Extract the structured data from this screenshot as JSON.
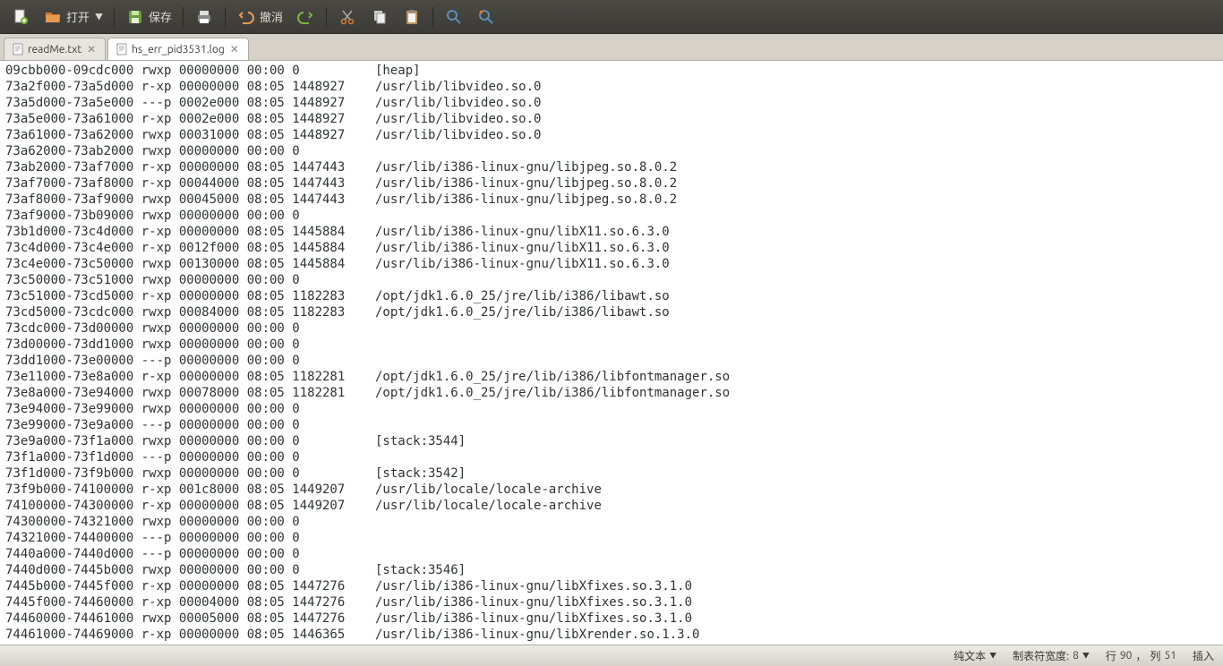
{
  "toolbar": {
    "new_label": "",
    "open_label": "打开",
    "save_label": "保存",
    "print_label": "",
    "undo_label": "撤消",
    "redo_label": "",
    "cut_label": "",
    "copy_label": "",
    "paste_label": "",
    "find_label": "",
    "replace_label": ""
  },
  "tabs": [
    {
      "label": "readMe.txt",
      "active": false
    },
    {
      "label": "hs_err_pid3531.log",
      "active": true
    }
  ],
  "editor_lines": [
    "09cbb000-09cdc000 rwxp 00000000 00:00 0          [heap]",
    "73a2f000-73a5d000 r-xp 00000000 08:05 1448927    /usr/lib/libvideo.so.0",
    "73a5d000-73a5e000 ---p 0002e000 08:05 1448927    /usr/lib/libvideo.so.0",
    "73a5e000-73a61000 r-xp 0002e000 08:05 1448927    /usr/lib/libvideo.so.0",
    "73a61000-73a62000 rwxp 00031000 08:05 1448927    /usr/lib/libvideo.so.0",
    "73a62000-73ab2000 rwxp 00000000 00:00 0 ",
    "73ab2000-73af7000 r-xp 00000000 08:05 1447443    /usr/lib/i386-linux-gnu/libjpeg.so.8.0.2",
    "73af7000-73af8000 r-xp 00044000 08:05 1447443    /usr/lib/i386-linux-gnu/libjpeg.so.8.0.2",
    "73af8000-73af9000 rwxp 00045000 08:05 1447443    /usr/lib/i386-linux-gnu/libjpeg.so.8.0.2",
    "73af9000-73b09000 rwxp 00000000 00:00 0 ",
    "73b1d000-73c4d000 r-xp 00000000 08:05 1445884    /usr/lib/i386-linux-gnu/libX11.so.6.3.0",
    "73c4d000-73c4e000 r-xp 0012f000 08:05 1445884    /usr/lib/i386-linux-gnu/libX11.so.6.3.0",
    "73c4e000-73c50000 rwxp 00130000 08:05 1445884    /usr/lib/i386-linux-gnu/libX11.so.6.3.0",
    "73c50000-73c51000 rwxp 00000000 00:00 0 ",
    "73c51000-73cd5000 r-xp 00000000 08:05 1182283    /opt/jdk1.6.0_25/jre/lib/i386/libawt.so",
    "73cd5000-73cdc000 rwxp 00084000 08:05 1182283    /opt/jdk1.6.0_25/jre/lib/i386/libawt.so",
    "73cdc000-73d00000 rwxp 00000000 00:00 0 ",
    "73d00000-73dd1000 rwxp 00000000 00:00 0 ",
    "73dd1000-73e00000 ---p 00000000 00:00 0 ",
    "73e11000-73e8a000 r-xp 00000000 08:05 1182281    /opt/jdk1.6.0_25/jre/lib/i386/libfontmanager.so",
    "73e8a000-73e94000 rwxp 00078000 08:05 1182281    /opt/jdk1.6.0_25/jre/lib/i386/libfontmanager.so",
    "73e94000-73e99000 rwxp 00000000 00:00 0 ",
    "73e99000-73e9a000 ---p 00000000 00:00 0 ",
    "73e9a000-73f1a000 rwxp 00000000 00:00 0          [stack:3544]",
    "73f1a000-73f1d000 ---p 00000000 00:00 0 ",
    "73f1d000-73f9b000 rwxp 00000000 00:00 0          [stack:3542]",
    "73f9b000-74100000 r-xp 001c8000 08:05 1449207    /usr/lib/locale/locale-archive",
    "74100000-74300000 r-xp 00000000 08:05 1449207    /usr/lib/locale/locale-archive",
    "74300000-74321000 rwxp 00000000 00:00 0 ",
    "74321000-74400000 ---p 00000000 00:00 0 ",
    "7440a000-7440d000 ---p 00000000 00:00 0 ",
    "7440d000-7445b000 rwxp 00000000 00:00 0          [stack:3546]",
    "7445b000-7445f000 r-xp 00000000 08:05 1447276    /usr/lib/i386-linux-gnu/libXfixes.so.3.1.0",
    "7445f000-74460000 r-xp 00004000 08:05 1447276    /usr/lib/i386-linux-gnu/libXfixes.so.3.1.0",
    "74460000-74461000 rwxp 00005000 08:05 1447276    /usr/lib/i386-linux-gnu/libXfixes.so.3.1.0",
    "74461000-74469000 r-xp 00000000 08:05 1446365    /usr/lib/i386-linux-gnu/libXrender.so.1.3.0"
  ],
  "statusbar": {
    "syntax": "纯文本",
    "tab_width_label": "制表符宽度:",
    "tab_width_value": "8",
    "line_label": "行",
    "line_value": "90",
    "col_label": "列",
    "col_value": "51",
    "insert_mode": "插入"
  }
}
